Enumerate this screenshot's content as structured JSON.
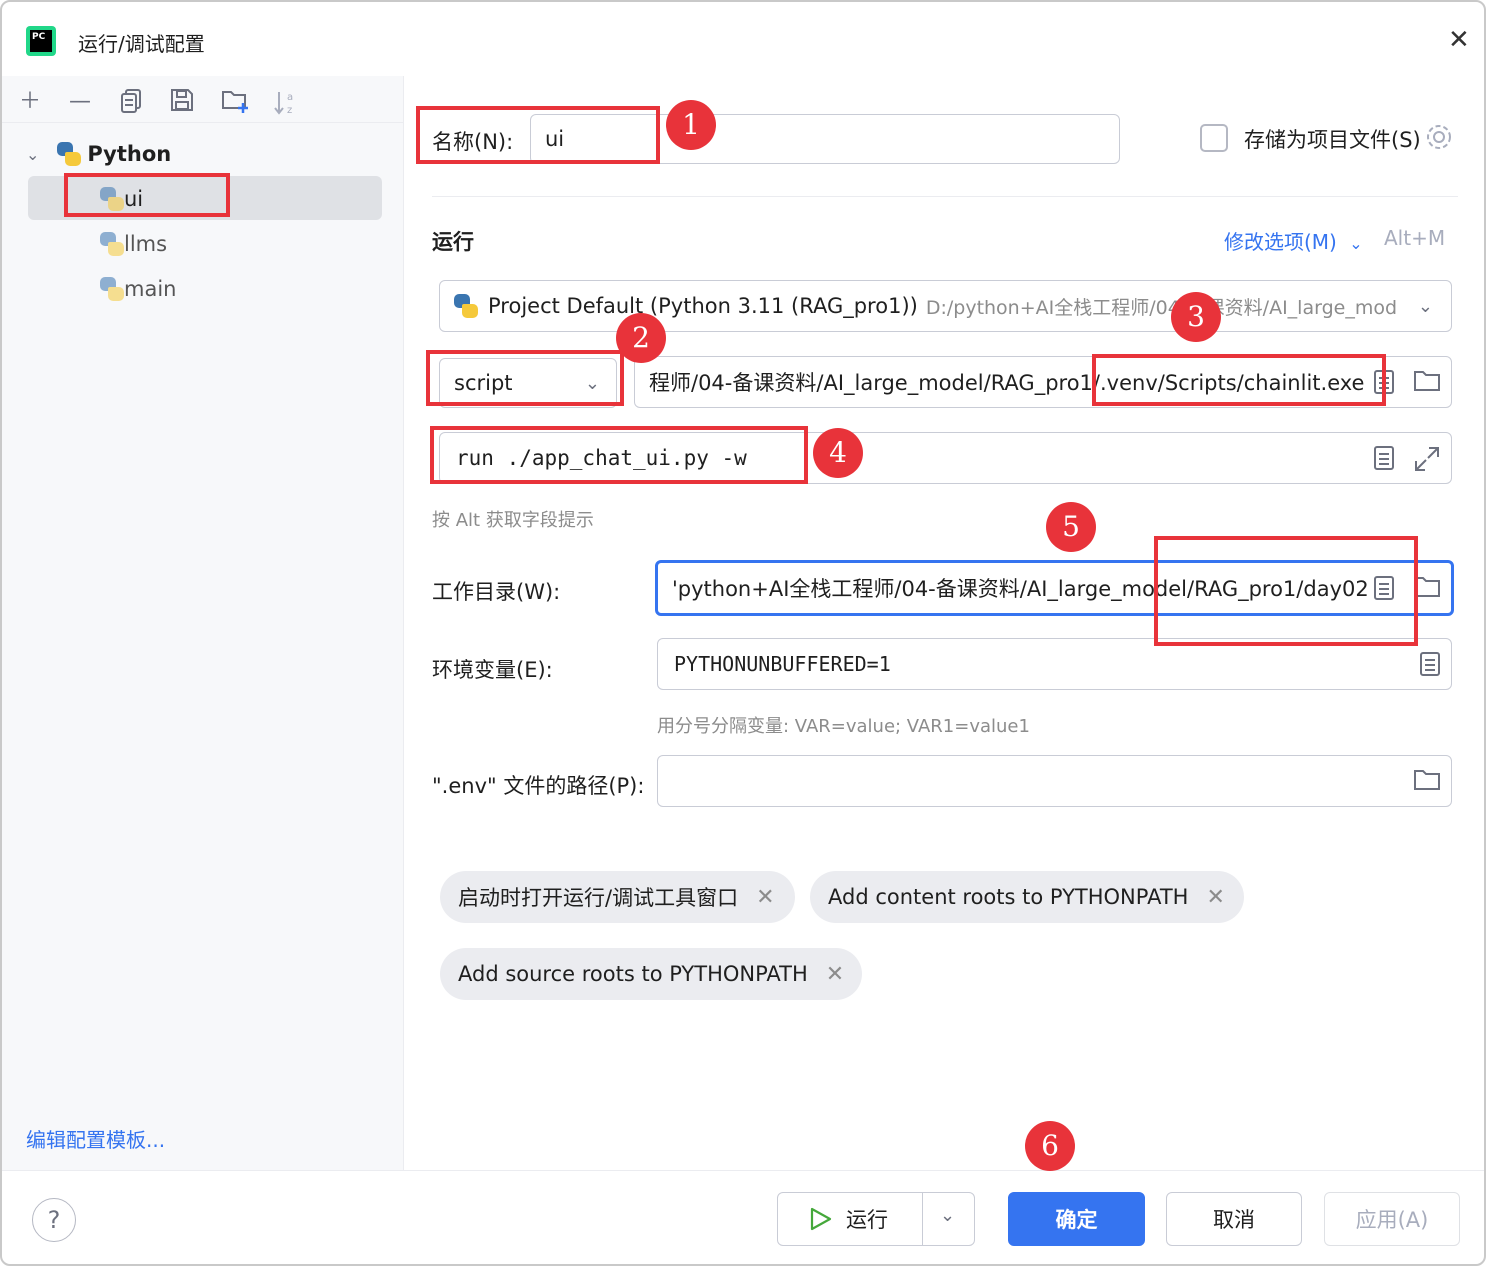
{
  "window": {
    "title": "运行/调试配置",
    "app_icon_text": "PC"
  },
  "tree": {
    "group": "Python",
    "items": [
      {
        "label": "ui"
      },
      {
        "label": "llms"
      },
      {
        "label": "main"
      }
    ]
  },
  "left_footer": {
    "edit_templates": "编辑配置模板..."
  },
  "form": {
    "name_label": "名称(N):",
    "name_value": "ui",
    "store_checkbox_label": "存储为项目文件(S)",
    "section_run": "运行",
    "modify_options": "修改选项(M)",
    "modify_shortcut": "Alt+M",
    "interpreter_name": "Project Default (Python 3.11 (RAG_pro1))",
    "interpreter_path": "D:/python+AI全栈工程师/04-备课资料/AI_large_mod",
    "run_type": "script",
    "script_path": "程师/04-备课资料/AI_large_model/RAG_pro1/.venv/Scripts/chainlit.exe",
    "parameters": "run ./app_chat_ui.py -w",
    "alt_hint": "按 Alt 获取字段提示",
    "workdir_label": "工作目录(W):",
    "workdir_value": "'python+AI全栈工程师/04-备课资料/AI_large_model/RAG_pro1/day02",
    "env_label": "环境变量(E):",
    "env_value": "PYTHONUNBUFFERED=1",
    "env_hint": "用分号分隔变量: VAR=value; VAR1=value1",
    "dotenv_label": "\".env\" 文件的路径(P):",
    "dotenv_value": ""
  },
  "chips": [
    {
      "label": "启动时打开运行/调试工具窗口"
    },
    {
      "label": "Add content roots to PYTHONPATH"
    },
    {
      "label": "Add source roots to PYTHONPATH"
    }
  ],
  "annotations": [
    "1",
    "2",
    "3",
    "4",
    "5",
    "6"
  ],
  "buttons": {
    "run": "运行",
    "ok": "确定",
    "cancel": "取消",
    "apply": "应用(A)",
    "help": "?"
  },
  "colors": {
    "accent": "#3574f0",
    "annotation_red": "#e8333a",
    "selection": "#dfe1e5"
  }
}
